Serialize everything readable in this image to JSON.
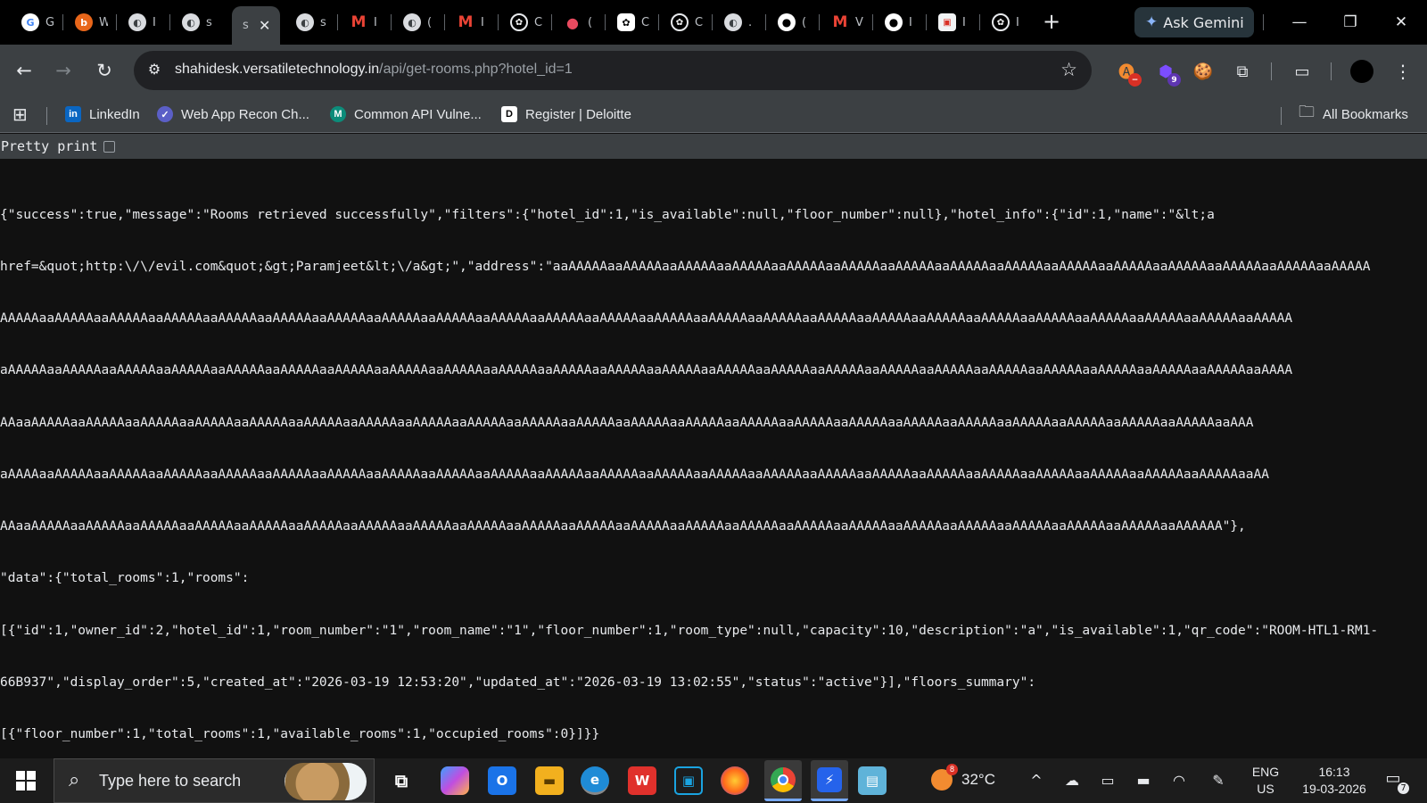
{
  "colors": {
    "accent": "#8ab4f8",
    "page_bg": "#111111",
    "toolbar_bg": "#3c4043",
    "tabstrip_bg": "#000000"
  },
  "tabs": [
    {
      "icon": "google-icon",
      "title": "G"
    },
    {
      "icon": "burp-icon",
      "title": "W"
    },
    {
      "icon": "globe-icon",
      "title": "I"
    },
    {
      "icon": "globe-icon",
      "title": "s"
    },
    {
      "icon": "none",
      "title": "s",
      "active": true
    },
    {
      "icon": "globe-icon",
      "title": "s"
    },
    {
      "icon": "gmail-icon",
      "title": "I"
    },
    {
      "icon": "globe-icon",
      "title": "("
    },
    {
      "icon": "gmail-icon",
      "title": "I"
    },
    {
      "icon": "chatgpt-icon",
      "title": "C"
    },
    {
      "icon": "cherry-icon",
      "title": "("
    },
    {
      "icon": "chatgpt-icon",
      "title": "C"
    },
    {
      "icon": "chatgpt-icon",
      "title": "C"
    },
    {
      "icon": "globe-icon",
      "title": "."
    },
    {
      "icon": "github-icon",
      "title": "("
    },
    {
      "icon": "gmail-icon",
      "title": "V"
    },
    {
      "icon": "github-icon",
      "title": "I"
    },
    {
      "icon": "image-icon",
      "title": "I"
    },
    {
      "icon": "chatgpt-icon",
      "title": "I"
    }
  ],
  "ask_gemini": "Ask Gemini",
  "address_bar": {
    "host": "shahidesk.versatiletechnology.in",
    "path": "/api/get-rooms.php?hotel_id=1"
  },
  "extensions": {
    "badge_count": "9"
  },
  "bookmarks": [
    {
      "icon": "linkedin-icon",
      "label": "LinkedIn"
    },
    {
      "icon": "webapp-recon-icon",
      "label": "Web App Recon Ch..."
    },
    {
      "icon": "api-vuln-icon",
      "label": "Common API Vulne..."
    },
    {
      "icon": "deloitte-icon",
      "label": "Register | Deloitte"
    }
  ],
  "all_bookmarks": "All Bookmarks",
  "pretty_print_label": "Pretty print",
  "json_lines": [
    "{\"success\":true,\"message\":\"Rooms retrieved successfully\",\"filters\":{\"hotel_id\":1,\"is_available\":null,\"floor_number\":null},\"hotel_info\":{\"id\":1,\"name\":\"&lt;a",
    "href=&quot;http:\\/\\/evil.com&quot;&gt;Paramjeet&lt;\\/a&gt;\",\"address\":\"aaAAAAAaaAAAAAaaAAAAAaaAAAAAaaAAAAAaaAAAAAaaAAAAAaaAAAAAaaAAAAAaaAAAAAaaAAAAAaaAAAAAaaAAAAAaaAAAAAaaAAAAA",
    "AAAAAaaAAAAAaaAAAAAaaAAAAAaaAAAAAaaAAAAAaaAAAAAaaAAAAAaaAAAAAaaAAAAAaaAAAAAaaAAAAAaaAAAAAaaAAAAAaaAAAAAaaAAAAAaaAAAAAaaAAAAAaaAAAAAaaAAAAAaaAAAAAaaAAAAAaaAAAAAaaAAAAA",
    "aAAAAAaaAAAAAaaAAAAAaaAAAAAaaAAAAAaaAAAAAaaAAAAAaaAAAAAaaAAAAAaaAAAAAaaAAAAAaaAAAAAaaAAAAAaaAAAAAaaAAAAAaaAAAAAaaAAAAAaaAAAAAaaAAAAAaaAAAAAaaAAAAAaaAAAAAaaAAAAAaaAAAA",
    "AAaaAAAAAaaAAAAAaaAAAAAaaAAAAAaaAAAAAaaAAAAAaaAAAAAaaAAAAAaaAAAAAaaAAAAAaaAAAAAaaAAAAAaaAAAAAaaAAAAAaaAAAAAaaAAAAAaaAAAAAaaAAAAAaaAAAAAaaAAAAAaaAAAAAaaAAAAAaaAAA",
    "aAAAAaaAAAAAaaAAAAAaaAAAAAaaAAAAAaaAAAAAaaAAAAAaaAAAAAaaAAAAAaaAAAAAaaAAAAAaaAAAAAaaAAAAAaaAAAAAaaAAAAAaaAAAAAaaAAAAAaaAAAAAaaAAAAAaaAAAAAaaAAAAAaaAAAAAaaAAAAAaaAA",
    "AAaaAAAAAaaAAAAAaaAAAAAaaAAAAAaaAAAAAaaAAAAAaaAAAAAaaAAAAAaaAAAAAaaAAAAAaaAAAAAaaAAAAAaaAAAAAaaAAAAAaaAAAAAaaAAAAAaaAAAAAaaAAAAAaaAAAAAaaAAAAAaaAAAAAaaAAAAAA\"},",
    "\"data\":{\"total_rooms\":1,\"rooms\":",
    "[{\"id\":1,\"owner_id\":2,\"hotel_id\":1,\"room_number\":\"1\",\"room_name\":\"1\",\"floor_number\":1,\"room_type\":null,\"capacity\":10,\"description\":\"a\",\"is_available\":1,\"qr_code\":\"ROOM-HTL1-RM1-",
    "66B937\",\"display_order\":5,\"created_at\":\"2026-03-19 12:53:20\",\"updated_at\":\"2026-03-19 13:02:55\",\"status\":\"active\"}],\"floors_summary\":",
    "[{\"floor_number\":1,\"total_rooms\":1,\"available_rooms\":1,\"occupied_rooms\":0}]}}"
  ],
  "taskbar": {
    "search_placeholder": "Type here to search",
    "apps": [
      "task-view-icon",
      "copilot-icon",
      "outlook-icon",
      "file-explorer-icon",
      "edge-icon",
      "wps-icon",
      "remote-app-icon",
      "firefox-icon",
      "chrome-icon",
      "power-automate-icon",
      "notepad-icon"
    ],
    "weather_temp": "32°C",
    "weather_badge": "8",
    "lang_top": "ENG",
    "lang_bottom": "US",
    "time": "16:13",
    "date": "19-03-2026",
    "notification_count": "7"
  }
}
